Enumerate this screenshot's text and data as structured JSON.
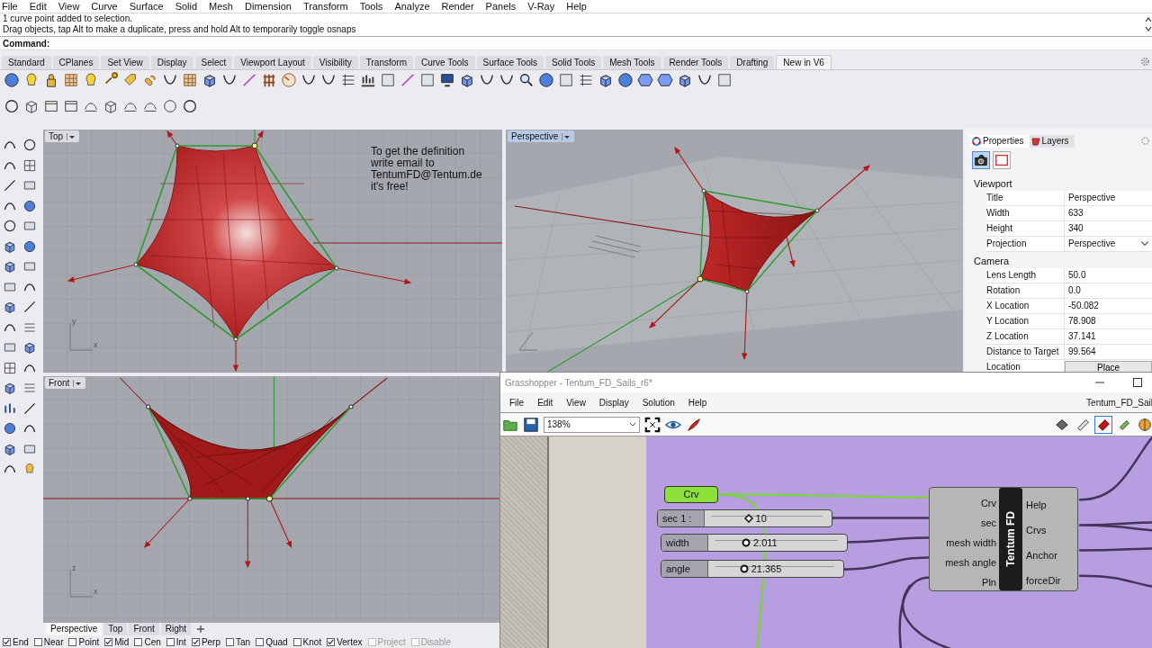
{
  "menu": [
    "File",
    "Edit",
    "View",
    "Curve",
    "Surface",
    "Solid",
    "Mesh",
    "Dimension",
    "Transform",
    "Tools",
    "Analyze",
    "Render",
    "Panels",
    "V-Ray",
    "Help"
  ],
  "command_history": [
    "1 curve point added to selection.",
    "Drag objects, tap Alt to make a duplicate, press and hold Alt to temporarily toggle osnaps"
  ],
  "command_prompt": "Command:",
  "toolbar_tabs": [
    {
      "label": "Standard",
      "selected": false
    },
    {
      "label": "CPlanes",
      "selected": false
    },
    {
      "label": "Set View",
      "selected": false
    },
    {
      "label": "Display",
      "selected": false
    },
    {
      "label": "Select",
      "selected": false
    },
    {
      "label": "Viewport Layout",
      "selected": false
    },
    {
      "label": "Visibility",
      "selected": false
    },
    {
      "label": "Transform",
      "selected": false
    },
    {
      "label": "Curve Tools",
      "selected": false
    },
    {
      "label": "Surface Tools",
      "selected": false
    },
    {
      "label": "Solid Tools",
      "selected": false
    },
    {
      "label": "Mesh Tools",
      "selected": false
    },
    {
      "label": "Render Tools",
      "selected": false
    },
    {
      "label": "Drafting",
      "selected": false
    },
    {
      "label": "New in V6",
      "selected": true
    }
  ],
  "viewports": [
    {
      "kind": "top",
      "title": "Top",
      "active": false,
      "note": "To get the definition\nwrite email to\nTentumFD@Tentum.de\nit's free!",
      "axis_labels": [
        "y",
        "x"
      ]
    },
    {
      "kind": "perspective",
      "title": "Perspective",
      "active": true
    },
    {
      "kind": "front",
      "title": "Front",
      "active": false,
      "axis_labels": [
        "z",
        "x"
      ]
    }
  ],
  "view_tabs": [
    {
      "label": "Perspective",
      "selected": true
    },
    {
      "label": "Top",
      "selected": false
    },
    {
      "label": "Front",
      "selected": false
    },
    {
      "label": "Right",
      "selected": false
    }
  ],
  "properties_panel": {
    "tabs": [
      {
        "label": "Properties",
        "selected": true
      },
      {
        "label": "Layers",
        "selected": false
      }
    ],
    "sections": [
      {
        "title": "Viewport",
        "rows": [
          {
            "label": "Title",
            "value": "Perspective",
            "kind": "text"
          },
          {
            "label": "Width",
            "value": "633",
            "kind": "text"
          },
          {
            "label": "Height",
            "value": "340",
            "kind": "text"
          },
          {
            "label": "Projection",
            "value": "Perspective",
            "kind": "dropdown"
          }
        ]
      },
      {
        "title": "Camera",
        "rows": [
          {
            "label": "Lens Length",
            "value": "50.0",
            "kind": "text"
          },
          {
            "label": "Rotation",
            "value": "0.0",
            "kind": "text"
          },
          {
            "label": "X Location",
            "value": "-50.082",
            "kind": "text"
          },
          {
            "label": "Y Location",
            "value": "78.908",
            "kind": "text"
          },
          {
            "label": "Z Location",
            "value": "37.141",
            "kind": "text"
          },
          {
            "label": "Distance to Target",
            "value": "99.564",
            "kind": "text"
          },
          {
            "label": "Location",
            "value": "Place",
            "kind": "button"
          }
        ]
      }
    ]
  },
  "osnaps": [
    {
      "label": "End",
      "checked": true,
      "disabled": false
    },
    {
      "label": "Near",
      "checked": false,
      "disabled": false
    },
    {
      "label": "Point",
      "checked": false,
      "disabled": false
    },
    {
      "label": "Mid",
      "checked": true,
      "disabled": false
    },
    {
      "label": "Cen",
      "checked": false,
      "disabled": false
    },
    {
      "label": "Int",
      "checked": false,
      "disabled": false
    },
    {
      "label": "Perp",
      "checked": true,
      "disabled": false
    },
    {
      "label": "Tan",
      "checked": false,
      "disabled": false
    },
    {
      "label": "Quad",
      "checked": false,
      "disabled": false
    },
    {
      "label": "Knot",
      "checked": false,
      "disabled": false
    },
    {
      "label": "Vertex",
      "checked": true,
      "disabled": false
    },
    {
      "label": "Project",
      "checked": false,
      "disabled": true
    },
    {
      "label": "Disable",
      "checked": false,
      "disabled": true
    }
  ],
  "grasshopper": {
    "title": "Grasshopper - Tentum_FD_Sails_r6*",
    "menu": [
      "File",
      "Edit",
      "View",
      "Display",
      "Solution",
      "Help"
    ],
    "document_tab": "Tentum_FD_Sail",
    "zoom": "138%",
    "param": {
      "label": "Crv"
    },
    "sliders": [
      {
        "label": "sec 1 :",
        "value": "10",
        "kind": "integer",
        "level": 0.33
      },
      {
        "label": "width",
        "value": "2.011",
        "kind": "float",
        "level": 0.25
      },
      {
        "label": "angle",
        "value": "21.365",
        "kind": "float",
        "level": 0.24
      }
    ],
    "component": {
      "name": "Tentum FD",
      "inputs": [
        "Crv",
        "sec",
        "mesh width",
        "mesh angle",
        "Pln"
      ],
      "outputs": [
        "Help",
        "Crvs",
        "Anchor",
        "forceDir"
      ]
    }
  }
}
